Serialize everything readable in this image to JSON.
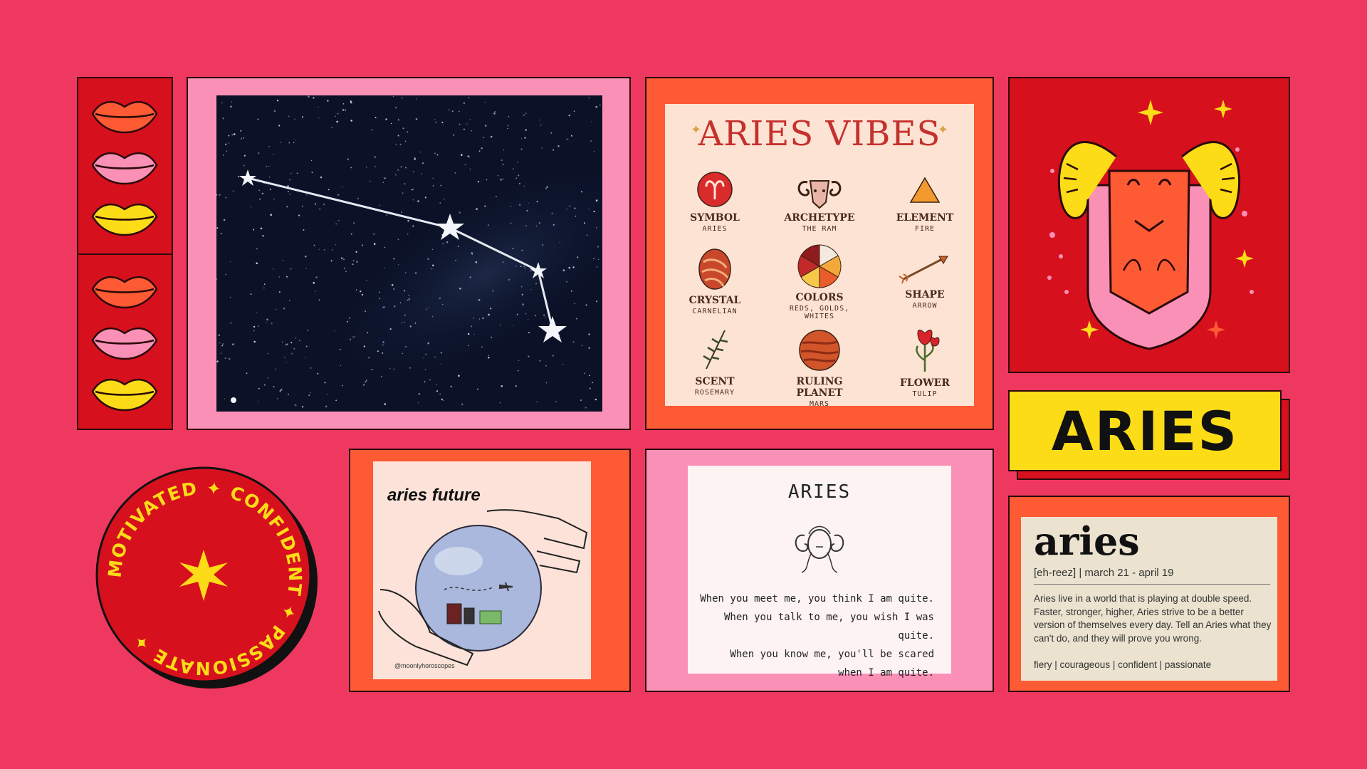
{
  "badge": {
    "words": "MOTIVATED ✦ CONFIDENT ✦ PASSIONATE ✦",
    "colors": {
      "fill": "#d7101e",
      "text": "#fcdc17",
      "shadow": "#111111"
    }
  },
  "vibes": {
    "title": "ARIES VIBES",
    "items": [
      {
        "label": "SYMBOL",
        "sub": "ARIES",
        "icon": "aries-symbol-icon"
      },
      {
        "label": "ARCHETYPE",
        "sub": "THE RAM",
        "icon": "ram-head-icon"
      },
      {
        "label": "ELEMENT",
        "sub": "FIRE",
        "icon": "triangle-icon"
      },
      {
        "label": "CRYSTAL",
        "sub": "CARNELIAN",
        "icon": "crystal-icon"
      },
      {
        "label": "COLORS",
        "sub": "REDS, GOLDS, WHITES",
        "icon": "color-wheel-icon"
      },
      {
        "label": "SHAPE",
        "sub": "ARROW",
        "icon": "arrow-icon"
      },
      {
        "label": "SCENT",
        "sub": "ROSEMARY",
        "icon": "rosemary-icon"
      },
      {
        "label": "RULING PLANET",
        "sub": "MARS",
        "icon": "mars-planet-icon"
      },
      {
        "label": "FLOWER",
        "sub": "TULIP",
        "icon": "tulip-icon"
      }
    ]
  },
  "banner": {
    "text": "ARIES"
  },
  "future": {
    "title": "aries future",
    "handle": "@moonlyhoroscopes"
  },
  "poem": {
    "title": "ARIES",
    "lines": [
      "When you meet me, you think I am quite.",
      "When you talk to me, you wish I was quite.",
      "When you know me, you'll be scared",
      "when I am quite."
    ]
  },
  "definition": {
    "word": "aries",
    "pronunciation": "[eh-reez] | march 21 - april 19",
    "body": "Aries live in a world that is playing at double speed. Faster, stronger, higher, Aries strive to be a better version of themselves every day. Tell an Aries what they can't do, and they will prove you wrong.",
    "traits": "fiery | courageous | confident | passionate"
  },
  "palette": {
    "background": "#ef3860",
    "red": "#d7101e",
    "pink": "#fb90b7",
    "orange": "#fe5a34",
    "yellow": "#fcdc17"
  }
}
